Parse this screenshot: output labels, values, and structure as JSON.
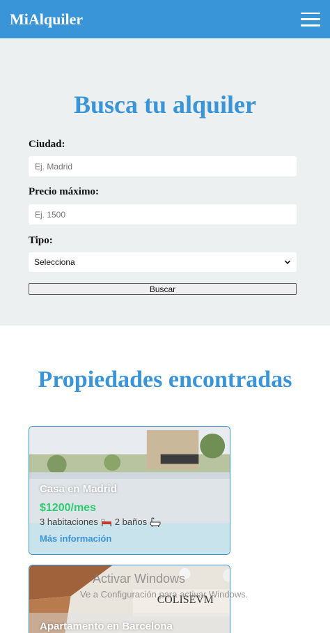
{
  "header": {
    "logo": "MiAlquiler",
    "menu_icon": "hamburger-menu-icon",
    "background_color": "#3a94d8"
  },
  "search": {
    "title": "Busca tu alquiler",
    "city_label": "Ciudad:",
    "city_placeholder": "Ej. Madrid",
    "city_value": "",
    "price_label": "Precio máximo:",
    "price_placeholder": "Ej. 1500",
    "price_value": "",
    "type_label": "Tipo:",
    "type_selected": "Selecciona",
    "submit_label": "Buscar"
  },
  "results": {
    "title": "Propiedades encontradas",
    "cards": [
      {
        "title": "Casa en Madrid",
        "price": "$1200/mes",
        "rooms": "3 habitaciones",
        "bed_icon": "bed-icon",
        "baths": "2 baños",
        "bath_icon": "bathtub-icon",
        "link": "Más información"
      },
      {
        "title": "Apartamento en Barcelona",
        "sign_text": "COLISEVM"
      }
    ]
  },
  "watermark": {
    "line1": "Activar Windows",
    "line2": "Ve a Configuración para activar Windows."
  },
  "colors": {
    "accent": "#3a94d8",
    "price": "#2ecc71",
    "section_bg": "#ecf0f1"
  }
}
